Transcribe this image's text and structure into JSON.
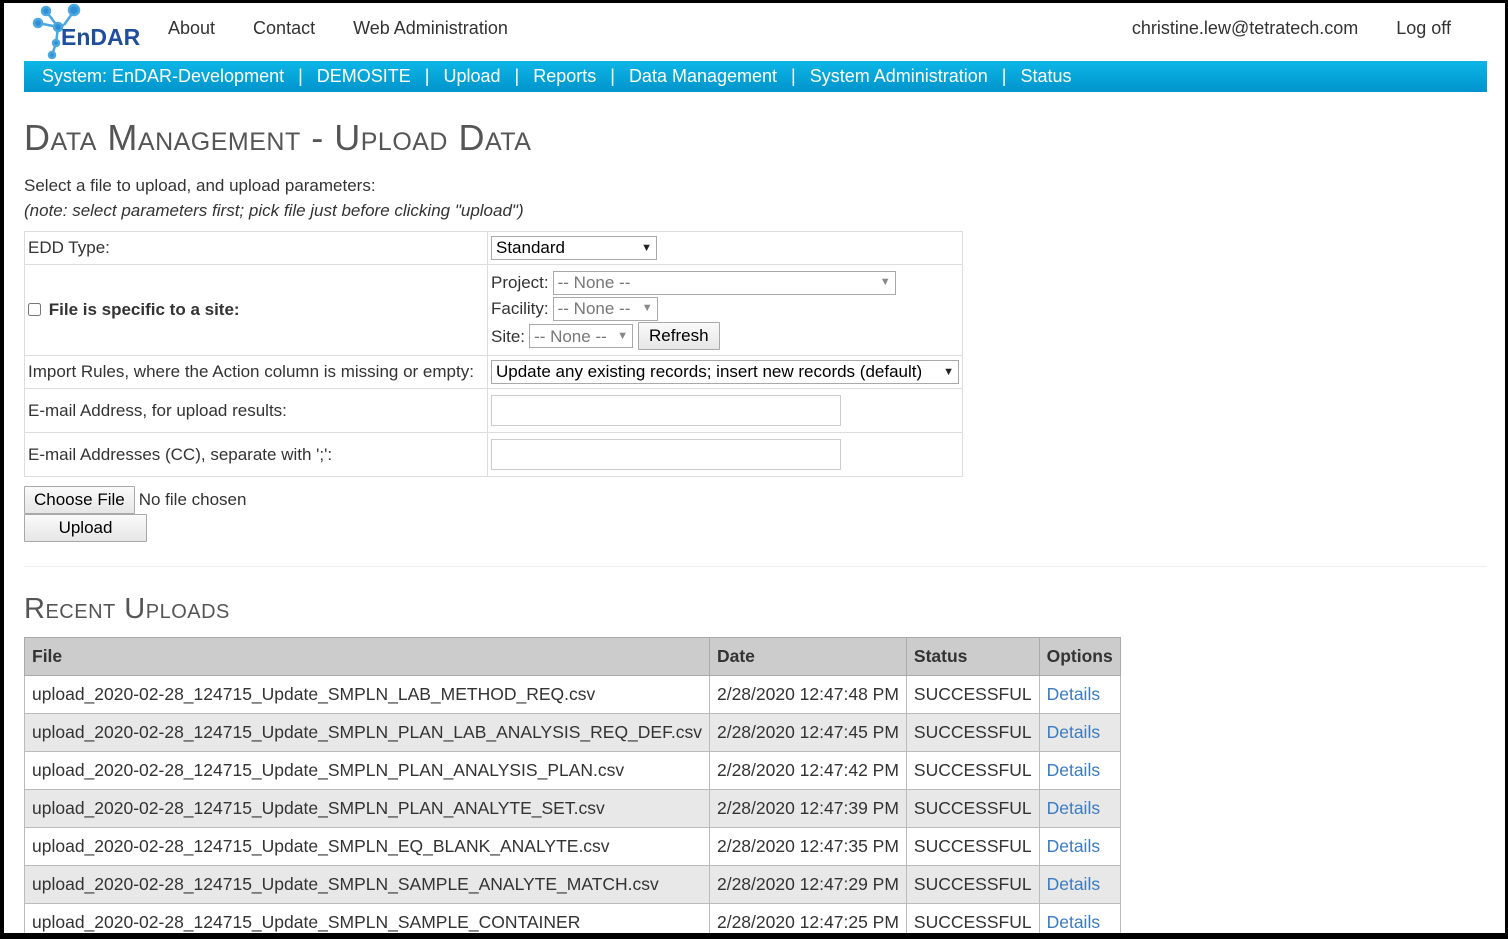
{
  "header": {
    "logo_text": "EnDAR",
    "links": [
      "About",
      "Contact",
      "Web Administration"
    ],
    "user_email": "christine.lew@tetratech.com",
    "logoff_label": "Log off"
  },
  "navbar": {
    "items": [
      "System: EnDAR-Development",
      "DEMOSITE",
      "Upload",
      "Reports",
      "Data Management",
      "System Administration",
      "Status"
    ],
    "separator": "|",
    "color": "#0aa8dc"
  },
  "page": {
    "title": "Data Management - Upload Data",
    "intro": "Select a file to upload, and upload parameters:",
    "note": "(note: select parameters first; pick file just before clicking \"upload\")"
  },
  "form": {
    "edd_type_label": "EDD Type:",
    "edd_type_value": "Standard",
    "site_specific_label": "File is specific to a site:",
    "site_specific_checked": false,
    "project_label": "Project:",
    "project_value": "-- None --",
    "facility_label": "Facility:",
    "facility_value": "-- None --",
    "site_label": "Site:",
    "site_value": "-- None --",
    "refresh_label": "Refresh",
    "import_rules_label": "Import Rules, where the Action column is missing or empty:",
    "import_rules_value": "Update any existing records; insert new records (default)",
    "email_label": "E-mail Address, for upload results:",
    "email_value": "",
    "cc_label": "E-mail Addresses (CC), separate with ';':",
    "cc_value": "",
    "choose_file_label": "Choose File",
    "no_file_text": "No file chosen",
    "upload_label": "Upload"
  },
  "recent": {
    "title": "Recent Uploads",
    "columns": [
      "File",
      "Date",
      "Status",
      "Options"
    ],
    "rows": [
      {
        "file": "upload_2020-02-28_124715_Update_SMPLN_LAB_METHOD_REQ.csv",
        "date": "2/28/2020 12:47:48 PM",
        "status": "SUCCESSFUL",
        "option": "Details"
      },
      {
        "file": "upload_2020-02-28_124715_Update_SMPLN_PLAN_LAB_ANALYSIS_REQ_DEF.csv",
        "date": "2/28/2020 12:47:45 PM",
        "status": "SUCCESSFUL",
        "option": "Details"
      },
      {
        "file": "upload_2020-02-28_124715_Update_SMPLN_PLAN_ANALYSIS_PLAN.csv",
        "date": "2/28/2020 12:47:42 PM",
        "status": "SUCCESSFUL",
        "option": "Details"
      },
      {
        "file": "upload_2020-02-28_124715_Update_SMPLN_PLAN_ANALYTE_SET.csv",
        "date": "2/28/2020 12:47:39 PM",
        "status": "SUCCESSFUL",
        "option": "Details"
      },
      {
        "file": "upload_2020-02-28_124715_Update_SMPLN_EQ_BLANK_ANALYTE.csv",
        "date": "2/28/2020 12:47:35 PM",
        "status": "SUCCESSFUL",
        "option": "Details"
      },
      {
        "file": "upload_2020-02-28_124715_Update_SMPLN_SAMPLE_ANALYTE_MATCH.csv",
        "date": "2/28/2020 12:47:29 PM",
        "status": "SUCCESSFUL",
        "option": "Details"
      },
      {
        "file": "upload_2020-02-28_124715_Update_SMPLN_SAMPLE_CONTAINER",
        "date": "2/28/2020 12:47:25 PM",
        "status": "SUCCESSFUL",
        "option": "Details"
      }
    ]
  }
}
